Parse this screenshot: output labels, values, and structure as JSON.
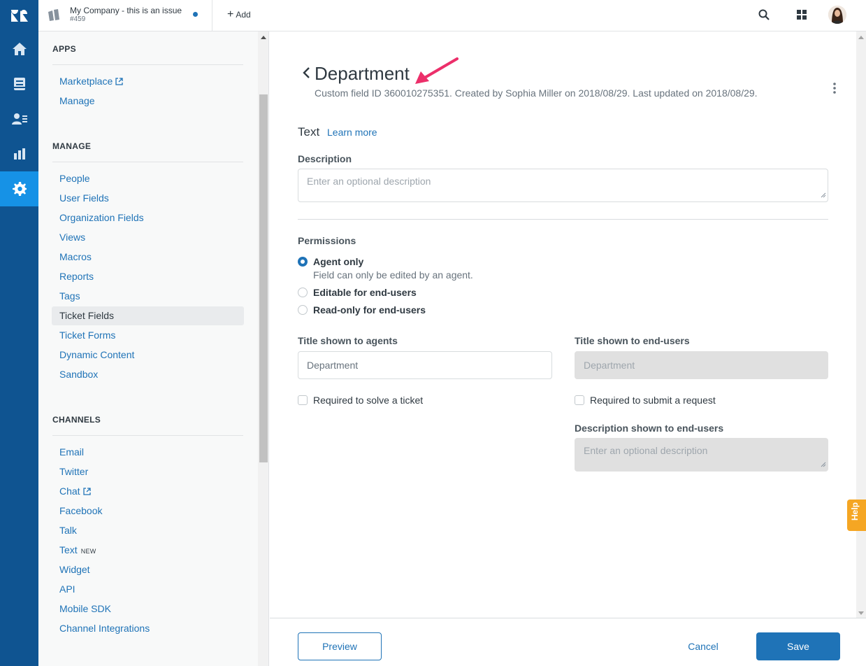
{
  "topbar": {
    "tab_title": "My Company - this is an issue",
    "tab_subtitle": "#459",
    "add_label": "Add"
  },
  "sidebar": {
    "apps_title": "APPS",
    "apps_items": [
      {
        "label": "Marketplace",
        "external": true
      },
      {
        "label": "Manage"
      }
    ],
    "manage_title": "MANAGE",
    "manage_items": [
      {
        "label": "People"
      },
      {
        "label": "User Fields"
      },
      {
        "label": "Organization Fields"
      },
      {
        "label": "Views"
      },
      {
        "label": "Macros"
      },
      {
        "label": "Reports"
      },
      {
        "label": "Tags"
      },
      {
        "label": "Ticket Fields",
        "active": true
      },
      {
        "label": "Ticket Forms"
      },
      {
        "label": "Dynamic Content"
      },
      {
        "label": "Sandbox"
      }
    ],
    "channels_title": "CHANNELS",
    "channels_items": [
      {
        "label": "Email"
      },
      {
        "label": "Twitter"
      },
      {
        "label": "Chat",
        "external": true
      },
      {
        "label": "Facebook"
      },
      {
        "label": "Talk"
      },
      {
        "label": "Text",
        "badge": "NEW"
      },
      {
        "label": "Widget"
      },
      {
        "label": "API"
      },
      {
        "label": "Mobile SDK"
      },
      {
        "label": "Channel Integrations"
      }
    ]
  },
  "main": {
    "title": "Department",
    "subtitle": "Custom field ID 360010275351. Created by Sophia Miller on 2018/08/29. Last updated on 2018/08/29.",
    "field_type": "Text",
    "learn_more": "Learn more",
    "description_label": "Description",
    "description_placeholder": "Enter an optional description",
    "permissions_label": "Permissions",
    "permissions": {
      "agent_only": "Agent only",
      "agent_only_hint": "Field can only be edited by an agent.",
      "editable_end_users": "Editable for end-users",
      "readonly_end_users": "Read-only for end-users",
      "selected": "Agent only"
    },
    "title_agents_label": "Title shown to agents",
    "title_agents_value": "Department",
    "title_end_users_label": "Title shown to end-users",
    "title_end_users_value": "Department",
    "required_solve": "Required to solve a ticket",
    "required_submit": "Required to submit a request",
    "desc_end_users_label": "Description shown to end-users",
    "desc_end_users_placeholder": "Enter an optional description"
  },
  "footer": {
    "preview": "Preview",
    "cancel": "Cancel",
    "save": "Save"
  },
  "help_label": "Help",
  "colors": {
    "accent": "#1f73b7",
    "rail": "#0f5491",
    "rail_active": "#1692e6",
    "annotation_arrow": "#ec2f6a",
    "help": "#f5a623"
  }
}
